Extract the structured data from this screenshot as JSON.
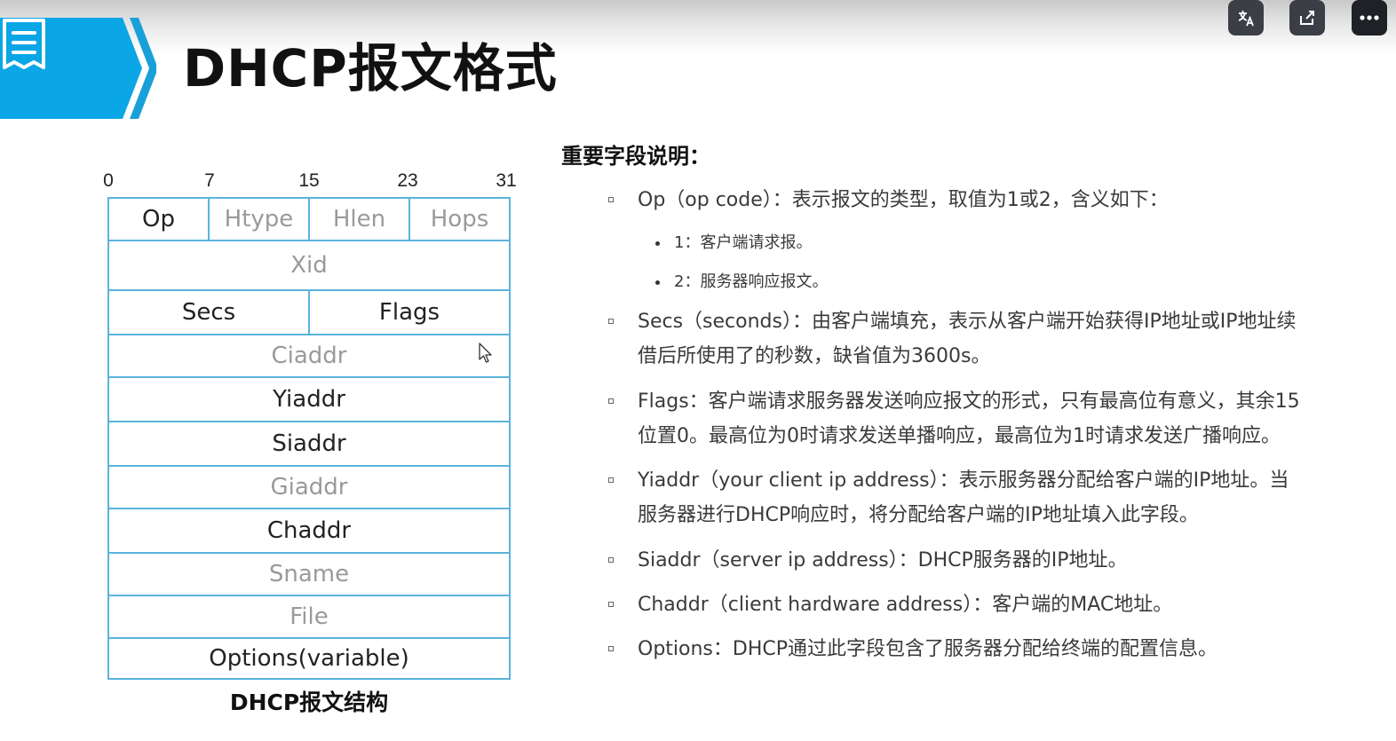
{
  "slide": {
    "title": "DHCP报文格式",
    "caption": "DHCP报文结构"
  },
  "bit_positions": [
    "0",
    "7",
    "15",
    "23",
    "31"
  ],
  "packet_rows": [
    [
      {
        "label": "Op",
        "tone": "dark"
      },
      {
        "label": "Htype",
        "tone": "gray"
      },
      {
        "label": "Hlen",
        "tone": "gray"
      },
      {
        "label": "Hops",
        "tone": "gray"
      }
    ],
    [
      {
        "label": "Xid",
        "tone": "gray"
      }
    ],
    [
      {
        "label": "Secs",
        "tone": "dark"
      },
      {
        "label": "Flags",
        "tone": "dark"
      }
    ],
    [
      {
        "label": "Ciaddr",
        "tone": "gray"
      }
    ],
    [
      {
        "label": "Yiaddr",
        "tone": "dark"
      }
    ],
    [
      {
        "label": "Siaddr",
        "tone": "dark"
      }
    ],
    [
      {
        "label": "Giaddr",
        "tone": "gray"
      }
    ],
    [
      {
        "label": "Chaddr",
        "tone": "dark"
      }
    ],
    [
      {
        "label": "Sname",
        "tone": "gray"
      }
    ],
    [
      {
        "label": "File",
        "tone": "gray"
      }
    ],
    [
      {
        "label": "Options(variable)",
        "tone": "dark"
      }
    ]
  ],
  "fields": {
    "heading": "重要字段说明：",
    "op": "Op（op code）：表示报文的类型，取值为1或2，含义如下：",
    "op_sub1": "1：客户端请求报。",
    "op_sub2": "2：服务器响应报文。",
    "secs_line1": "Secs（seconds）：由客户端填充，表示从客户端开始获得IP地址或IP地址续",
    "secs_line2": "借后所使用了的秒数，缺省值为3600s。",
    "flags_line1": "Flags：客户端请求服务器发送响应报文的形式，只有最高位有意义，其余15",
    "flags_line2": "位置0。最高位为0时请求发送单播响应，最高位为1时请求发送广播响应。",
    "yiaddr_line1": "Yiaddr（your client ip address）：表示服务器分配给客户端的IP地址。当",
    "yiaddr_line2": "服务器进行DHCP响应时，将分配给客户端的IP地址填入此字段。",
    "siaddr": "Siaddr（server ip address）：DHCP服务器的IP地址。",
    "chaddr": "Chaddr（client hardware address）：客户端的MAC地址。",
    "options": "Options：DHCP通过此字段包含了服务器分配给终端的配置信息。"
  },
  "colors": {
    "banner": "#0aa6e6",
    "banner_chevron": "#1aa0d8",
    "table_line": "#5ab4dc",
    "control_bg": "#3b3f45"
  },
  "icons": {
    "banner": "document-icon",
    "controls": [
      "translate-icon",
      "share-icon",
      "more-icon"
    ]
  }
}
